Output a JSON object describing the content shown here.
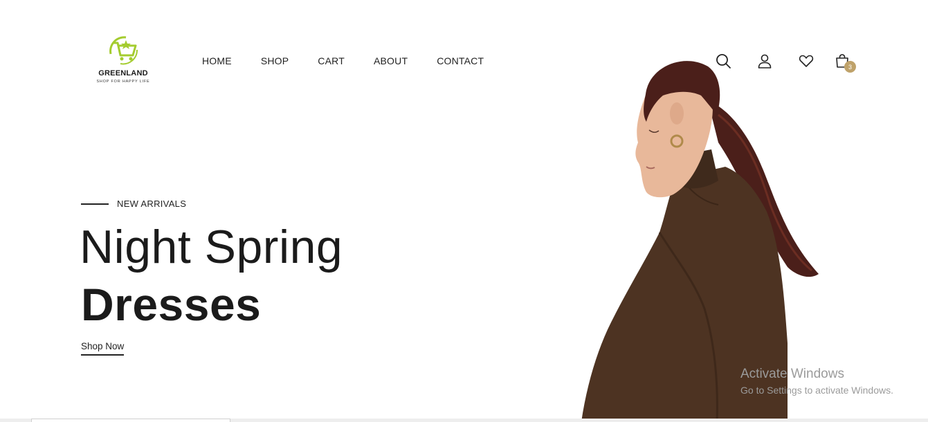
{
  "brand": {
    "name": "GREENLAND",
    "tagline": "SHOP FOR HAPPY LIFE",
    "logo_color": "#a4cc2f"
  },
  "nav": {
    "items": [
      {
        "label": "HOME"
      },
      {
        "label": "SHOP"
      },
      {
        "label": "CART"
      },
      {
        "label": "ABOUT"
      },
      {
        "label": "CONTACT"
      }
    ]
  },
  "header_icons": {
    "search": "search-icon",
    "account": "user-icon",
    "wishlist": "heart-icon",
    "cart": "shopping-bag-icon",
    "cart_count": "3",
    "badge_color": "#bfa26a"
  },
  "hero": {
    "subtitle": "NEW ARRIVALS",
    "title_light": "Night Spring",
    "title_bold": "Dresses",
    "cta_label": "Shop Now"
  },
  "system_overlay": {
    "title": "Activate Windows",
    "subtitle": "Go to Settings to activate Windows."
  }
}
